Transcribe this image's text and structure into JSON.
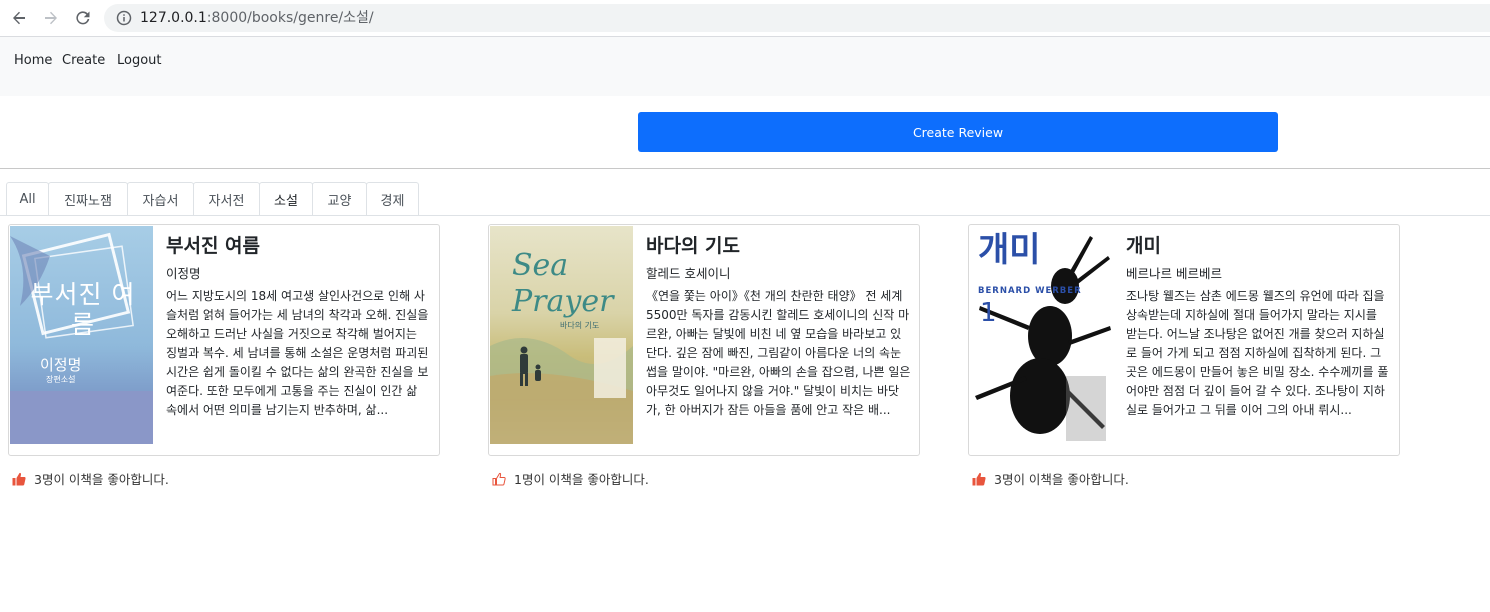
{
  "browser": {
    "url_host": "127.0.0.1",
    "url_path": ":8000/books/genre/소설/"
  },
  "navbar": {
    "home": "Home",
    "create": "Create",
    "logout": "Logout"
  },
  "create_review_label": "Create Review",
  "tabs": [
    {
      "label": "All"
    },
    {
      "label": "진짜노잼"
    },
    {
      "label": "자습서"
    },
    {
      "label": "자서전"
    },
    {
      "label": "소설"
    },
    {
      "label": "교양"
    },
    {
      "label": "경제"
    }
  ],
  "active_tab": "소설",
  "books": [
    {
      "title": "부서진 여름",
      "author": "이정명",
      "description": "어느 지방도시의 18세 여고생 살인사건으로 인해 사슬처럼 얽혀 들어가는 세 남녀의 착각과 오해. 진실을 오해하고 드러난 사실을 거짓으로 착각해 벌어지는 징벌과 복수. 세 남녀를 통해 소설은 운명처럼 파괴된 시간은 쉽게 돌이킬 수 없다는 삶의 완곡한 진실을 보여준다. 또한 모두에게 고통을 주는 진실이 인간 삶 속에서 어떤 의미를 남기는지 반추하며, 삶...",
      "cover_text": "부서진 여름",
      "cover_author": "이정명",
      "cover_sub": "장편소설",
      "likes": "3명이 이책을 좋아합니다."
    },
    {
      "title": "바다의 기도",
      "author": "할레드 호세이니",
      "description": "《연을 쫓는 아이》《천 개의 찬란한 태양》 전 세계 5500만 독자를 감동시킨 할레드 호세이니의 신작 마르완, 아빠는 달빛에 비친 네 옆 모습을 바라보고 있단다. 깊은 잠에 빠진, 그림같이 아름다운 너의 속눈썹을 말이야. \"마르완, 아빠의 손을 잡으렴, 나쁜 일은 아무것도 일어나지 않을 거야.\" 달빛이 비치는 바닷가, 한 아버지가 잠든 아들을 품에 안고 작은 배...",
      "cover_text": "Sea Prayer",
      "cover_sub": "바다의 기도",
      "likes": "1명이 이책을 좋아합니다."
    },
    {
      "title": "개미",
      "author": "베르나르 베르베르",
      "description": "조나탕 웰즈는 삼촌 에드몽 웰즈의 유언에 따라 집을 상속받는데 지하실에 절대 들어가지 말라는 지시를 받는다. 어느날 조나탕은 없어진 개를 찾으러 지하실로 들어 가게 되고 점점 지하실에 집착하게 된다. 그곳은 에드몽이 만들어 놓은 비밀 장소. 수수께끼를 풀어야만 점점 더 깊이 들어 갈 수 있다. 조나탕이 지하실로 들어가고 그 뒤를 이어 그의 아내 뤼시...",
      "cover_text": "개미",
      "cover_author": "BERNARD WERBER",
      "cover_num": "1",
      "likes": "3명이 이책을 좋아합니다."
    }
  ],
  "colors": {
    "primary": "#0d6efd",
    "like_icon": "#e8553d"
  }
}
